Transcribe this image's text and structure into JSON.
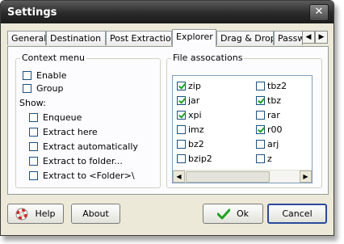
{
  "window": {
    "title": "Settings"
  },
  "tabs": [
    "General",
    "Destination",
    "Post Extraction",
    "Explorer",
    "Drag & Drop",
    "Password"
  ],
  "active_tab": "Explorer",
  "context_menu": {
    "legend": "Context menu",
    "enable_label": "Enable",
    "group_label": "Group",
    "show_label": "Show:",
    "show_items": [
      "Enqueue",
      "Extract here",
      "Extract automatically",
      "Extract to folder...",
      "Extract to <Folder>\\"
    ]
  },
  "file_assoc": {
    "legend": "File assocations",
    "items": [
      {
        "label": "zip",
        "checked": true
      },
      {
        "label": "tbz2",
        "checked": false
      },
      {
        "label": "jar",
        "checked": true
      },
      {
        "label": "tbz",
        "checked": true
      },
      {
        "label": "xpi",
        "checked": true
      },
      {
        "label": "rar",
        "checked": false
      },
      {
        "label": "imz",
        "checked": false
      },
      {
        "label": "r00",
        "checked": true
      },
      {
        "label": "bz2",
        "checked": false
      },
      {
        "label": "arj",
        "checked": false
      },
      {
        "label": "bzip2",
        "checked": false
      },
      {
        "label": "z",
        "checked": false
      }
    ]
  },
  "buttons": {
    "help": "Help",
    "about": "About",
    "ok": "Ok",
    "cancel": "Cancel"
  },
  "icons": {
    "help": "lifebuoy-icon",
    "ok": "green-check-icon",
    "close": "close-icon"
  },
  "colors": {
    "check": "#21a121",
    "help_ring": "#d32020"
  }
}
